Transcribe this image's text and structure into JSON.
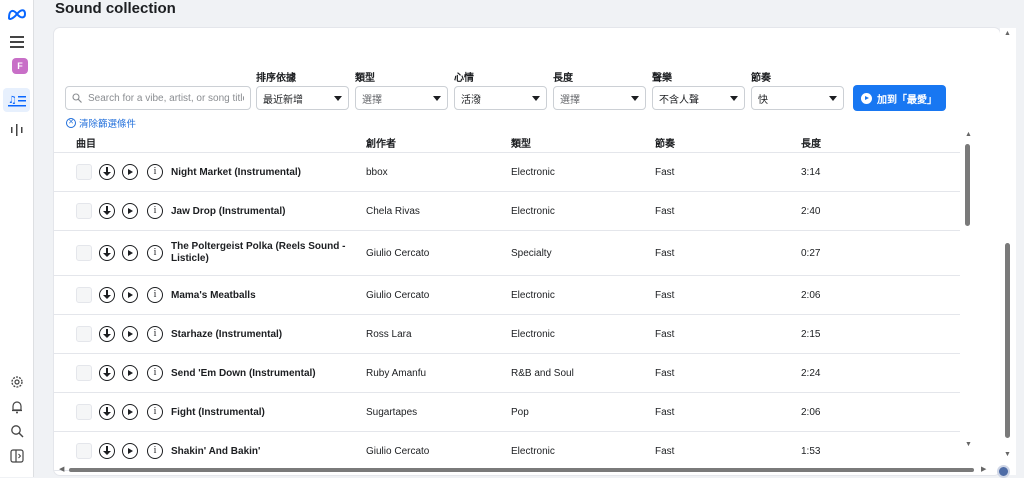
{
  "page_title": "Sound collection",
  "rail": {
    "logo": "meta-logo",
    "avatar_letter": "F",
    "icons": [
      "menu-icon",
      "music-list-icon",
      "audio-bars-icon",
      "settings-icon",
      "bell-icon",
      "search-icon",
      "sidebar-panel-icon"
    ]
  },
  "search": {
    "placeholder": "Search for a vibe, artist, or song title"
  },
  "filters": [
    {
      "label": "排序依據",
      "value": "最近新增",
      "placeholder": false
    },
    {
      "label": "類型",
      "value": "選擇",
      "placeholder": true
    },
    {
      "label": "心情",
      "value": "活潑",
      "placeholder": false
    },
    {
      "label": "長度",
      "value": "選擇",
      "placeholder": true
    },
    {
      "label": "聲樂",
      "value": "不含人聲",
      "placeholder": false
    },
    {
      "label": "節奏",
      "value": "快",
      "placeholder": false
    }
  ],
  "add_favorite_label": "加到「最愛」",
  "clear_filters_label": "清除篩選條件",
  "columns": [
    "曲目",
    "創作者",
    "類型",
    "節奏",
    "長度"
  ],
  "tracks": [
    {
      "title": "Night Market (Instrumental)",
      "creator": "bbox",
      "genre": "Electronic",
      "tempo": "Fast",
      "length": "3:14"
    },
    {
      "title": "Jaw Drop (Instrumental)",
      "creator": "Chela Rivas",
      "genre": "Electronic",
      "tempo": "Fast",
      "length": "2:40"
    },
    {
      "title": "The Poltergeist Polka (Reels Sound - Listicle)",
      "creator": "Giulio Cercato",
      "genre": "Specialty",
      "tempo": "Fast",
      "length": "0:27"
    },
    {
      "title": "Mama's Meatballs",
      "creator": "Giulio Cercato",
      "genre": "Electronic",
      "tempo": "Fast",
      "length": "2:06"
    },
    {
      "title": "Starhaze (Instrumental)",
      "creator": "Ross Lara",
      "genre": "Electronic",
      "tempo": "Fast",
      "length": "2:15"
    },
    {
      "title": "Send 'Em Down (Instrumental)",
      "creator": "Ruby Amanfu",
      "genre": "R&B and Soul",
      "tempo": "Fast",
      "length": "2:24"
    },
    {
      "title": "Fight (Instrumental)",
      "creator": "Sugartapes",
      "genre": "Pop",
      "tempo": "Fast",
      "length": "2:06"
    },
    {
      "title": "Shakin' And Bakin'",
      "creator": "Giulio Cercato",
      "genre": "Electronic",
      "tempo": "Fast",
      "length": "1:53"
    }
  ],
  "colors": {
    "accent": "#1877f2",
    "link": "#216fdb",
    "background": "#f0f2f5"
  }
}
